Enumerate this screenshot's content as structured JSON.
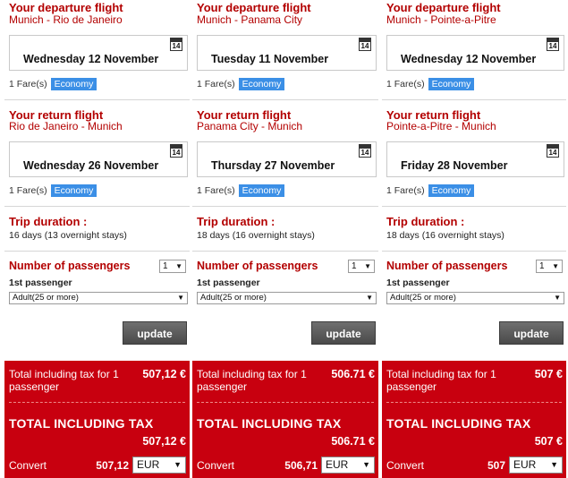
{
  "columns": [
    {
      "departure": {
        "title": "Your departure flight",
        "route": "Munich - Rio de Janeiro",
        "date": "Wednesday 12 November"
      },
      "return": {
        "title": "Your return flight",
        "route": "Rio de Janeiro - Munich",
        "date": "Wednesday 26 November"
      },
      "calendar_day": "14",
      "fares": "1 Fare(s)",
      "fare_class": "Economy",
      "trip_label": "Trip duration :",
      "trip_value": "16 days (13 overnight stays)",
      "passengers_label": "Number of passengers",
      "passengers_count": "1",
      "first_passenger": "1st passenger",
      "passenger_type": "Adult(25 or more)",
      "update": "update",
      "total_per": "Total including tax for 1 passenger",
      "total_per_amount": "507,12 €",
      "total_label": "TOTAL INCLUDING TAX",
      "total_amount": "507,12 €",
      "convert_label": "Convert",
      "convert_amount": "507,12",
      "currency": "EUR"
    },
    {
      "departure": {
        "title": "Your departure flight",
        "route": "Munich - Panama City",
        "date": "Tuesday 11 November"
      },
      "return": {
        "title": "Your return flight",
        "route": "Panama City - Munich",
        "date": "Thursday 27 November"
      },
      "calendar_day": "14",
      "fares": "1 Fare(s)",
      "fare_class": "Economy",
      "trip_label": "Trip duration :",
      "trip_value": "18 days (16 overnight stays)",
      "passengers_label": "Number of passengers",
      "passengers_count": "1",
      "first_passenger": "1st passenger",
      "passenger_type": "Adult(25 or more)",
      "update": "update",
      "total_per": "Total including tax for 1 passenger",
      "total_per_amount": "506.71 €",
      "total_label": "TOTAL INCLUDING TAX",
      "total_amount": "506.71 €",
      "convert_label": "Convert",
      "convert_amount": "506,71",
      "currency": "EUR"
    },
    {
      "departure": {
        "title": "Your departure flight",
        "route": "Munich - Pointe-a-Pitre",
        "date": "Wednesday 12 November"
      },
      "return": {
        "title": "Your return flight",
        "route": "Pointe-a-Pitre - Munich",
        "date": "Friday 28 November"
      },
      "calendar_day": "14",
      "fares": "1 Fare(s)",
      "fare_class": "Economy",
      "trip_label": "Trip duration :",
      "trip_value": "18 days (16 overnight stays)",
      "passengers_label": "Number of passengers",
      "passengers_count": "1",
      "first_passenger": "1st passenger",
      "passenger_type": "Adult(25 or more)",
      "update": "update",
      "total_per": "Total including tax for 1 passenger",
      "total_per_amount": "507 €",
      "total_label": "TOTAL INCLUDING TAX",
      "total_amount": "507 €",
      "convert_label": "Convert",
      "convert_amount": "507",
      "currency": "EUR"
    }
  ],
  "colors": {
    "accent_red": "#b30000",
    "total_bg": "#c8000f",
    "economy_badge": "#3b8fe6"
  },
  "icons": {
    "calendar": "calendar-icon",
    "dropdown": "chevron-down-icon"
  }
}
